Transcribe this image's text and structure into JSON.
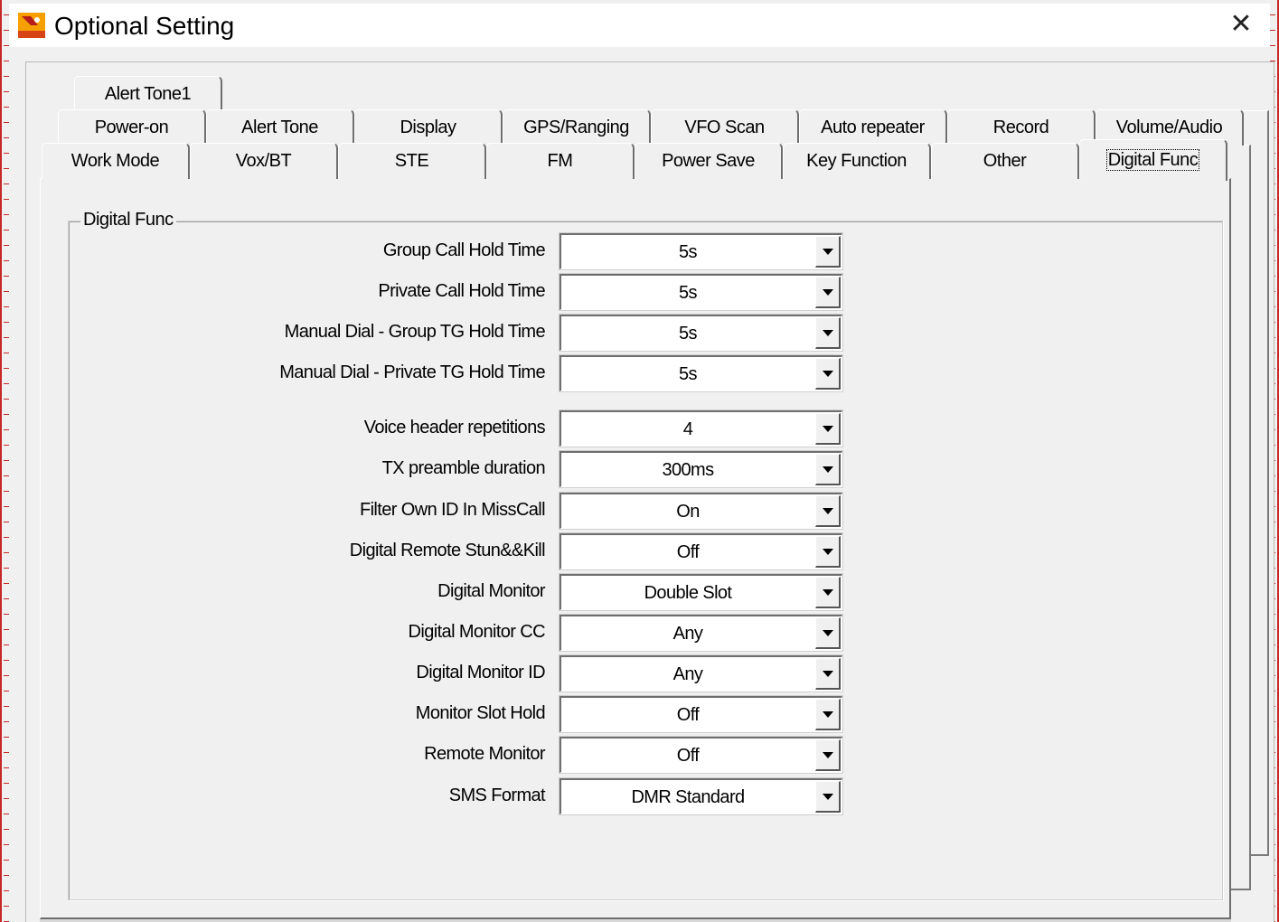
{
  "window": {
    "title": "Optional Setting",
    "close_glyph": "✕"
  },
  "tabs": {
    "row1": [
      {
        "label": "Alert Tone1"
      }
    ],
    "row2": [
      {
        "label": "Power-on"
      },
      {
        "label": "Alert Tone"
      },
      {
        "label": "Display"
      },
      {
        "label": "GPS/Ranging"
      },
      {
        "label": "VFO Scan"
      },
      {
        "label": "Auto repeater"
      },
      {
        "label": "Record"
      },
      {
        "label": "Volume/Audio"
      }
    ],
    "row3": [
      {
        "label": "Work Mode"
      },
      {
        "label": "Vox/BT"
      },
      {
        "label": "STE"
      },
      {
        "label": "FM"
      },
      {
        "label": "Power Save"
      },
      {
        "label": "Key Function"
      },
      {
        "label": "Other"
      },
      {
        "label": "Digital Func"
      }
    ],
    "active": "Digital Func"
  },
  "group": {
    "title": "Digital Func",
    "fields": [
      {
        "label": "Group Call Hold Time",
        "value": "5s"
      },
      {
        "label": "Private Call Hold Time",
        "value": "5s"
      },
      {
        "label": "Manual Dial - Group TG Hold Time",
        "value": "5s"
      },
      {
        "label": "Manual Dial - Private TG Hold Time",
        "value": "5s"
      },
      {
        "label": "Voice header repetitions",
        "value": "4"
      },
      {
        "label": "TX preamble duration",
        "value": "300ms"
      },
      {
        "label": "Filter Own ID In MissCall",
        "value": "On"
      },
      {
        "label": "Digital Remote Stun&&Kill",
        "value": "Off"
      },
      {
        "label": "Digital Monitor",
        "value": "Double Slot"
      },
      {
        "label": "Digital Monitor CC",
        "value": "Any"
      },
      {
        "label": "Digital Monitor ID",
        "value": "Any"
      },
      {
        "label": "Monitor Slot Hold",
        "value": "Off"
      },
      {
        "label": "Remote Monitor",
        "value": "Off"
      },
      {
        "label": "SMS Format",
        "value": "DMR Standard"
      }
    ]
  },
  "colors": {
    "frame_red": "#c62828",
    "dialog_bg": "#f0f0f0"
  }
}
